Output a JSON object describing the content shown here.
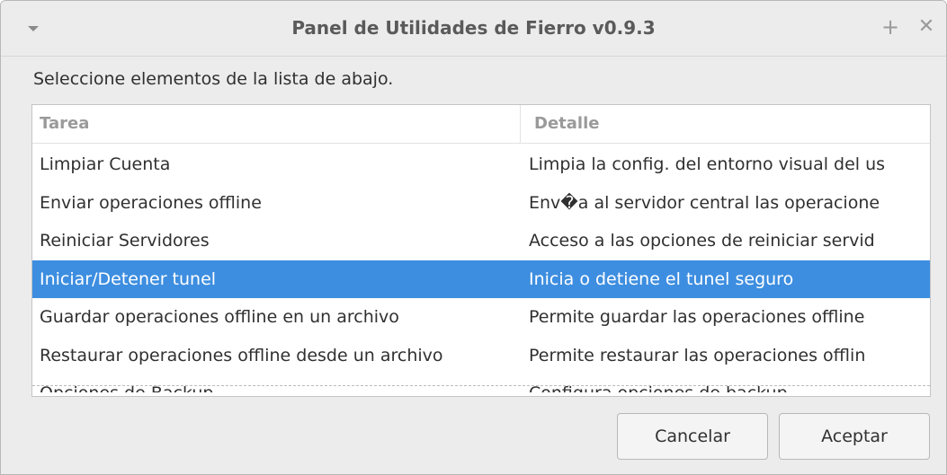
{
  "window": {
    "title": "Panel de Utilidades de Fierro v0.9.3",
    "maximize_glyph": "+",
    "close_glyph": "✕"
  },
  "instruction": "Seleccione elementos de la lista de abajo.",
  "table": {
    "columns": [
      "Tarea",
      "Detalle"
    ],
    "rows": [
      {
        "tarea": "Limpiar Cuenta",
        "detalle": "Limpia la config. del entorno visual del us"
      },
      {
        "tarea": "Enviar operaciones offline",
        "detalle": "Env�a al servidor central las operacione"
      },
      {
        "tarea": "Reiniciar Servidores",
        "detalle": "Acceso a las opciones de reiniciar servid"
      },
      {
        "tarea": "Iniciar/Detener tunel",
        "detalle": "Inicia o detiene el tunel seguro"
      },
      {
        "tarea": "Guardar operaciones offline en un archivo",
        "detalle": "Permite guardar las operaciones offline"
      },
      {
        "tarea": "Restaurar operaciones offline desde un archivo",
        "detalle": "Permite restaurar las operaciones offlin"
      },
      {
        "tarea": "Opciones de Backup",
        "detalle": "Configura opciones de backup"
      }
    ],
    "selected_index": 3
  },
  "buttons": {
    "cancel": "Cancelar",
    "accept": "Aceptar"
  },
  "colors": {
    "selection": "#3d8ee0",
    "window_bg": "#ececec"
  }
}
